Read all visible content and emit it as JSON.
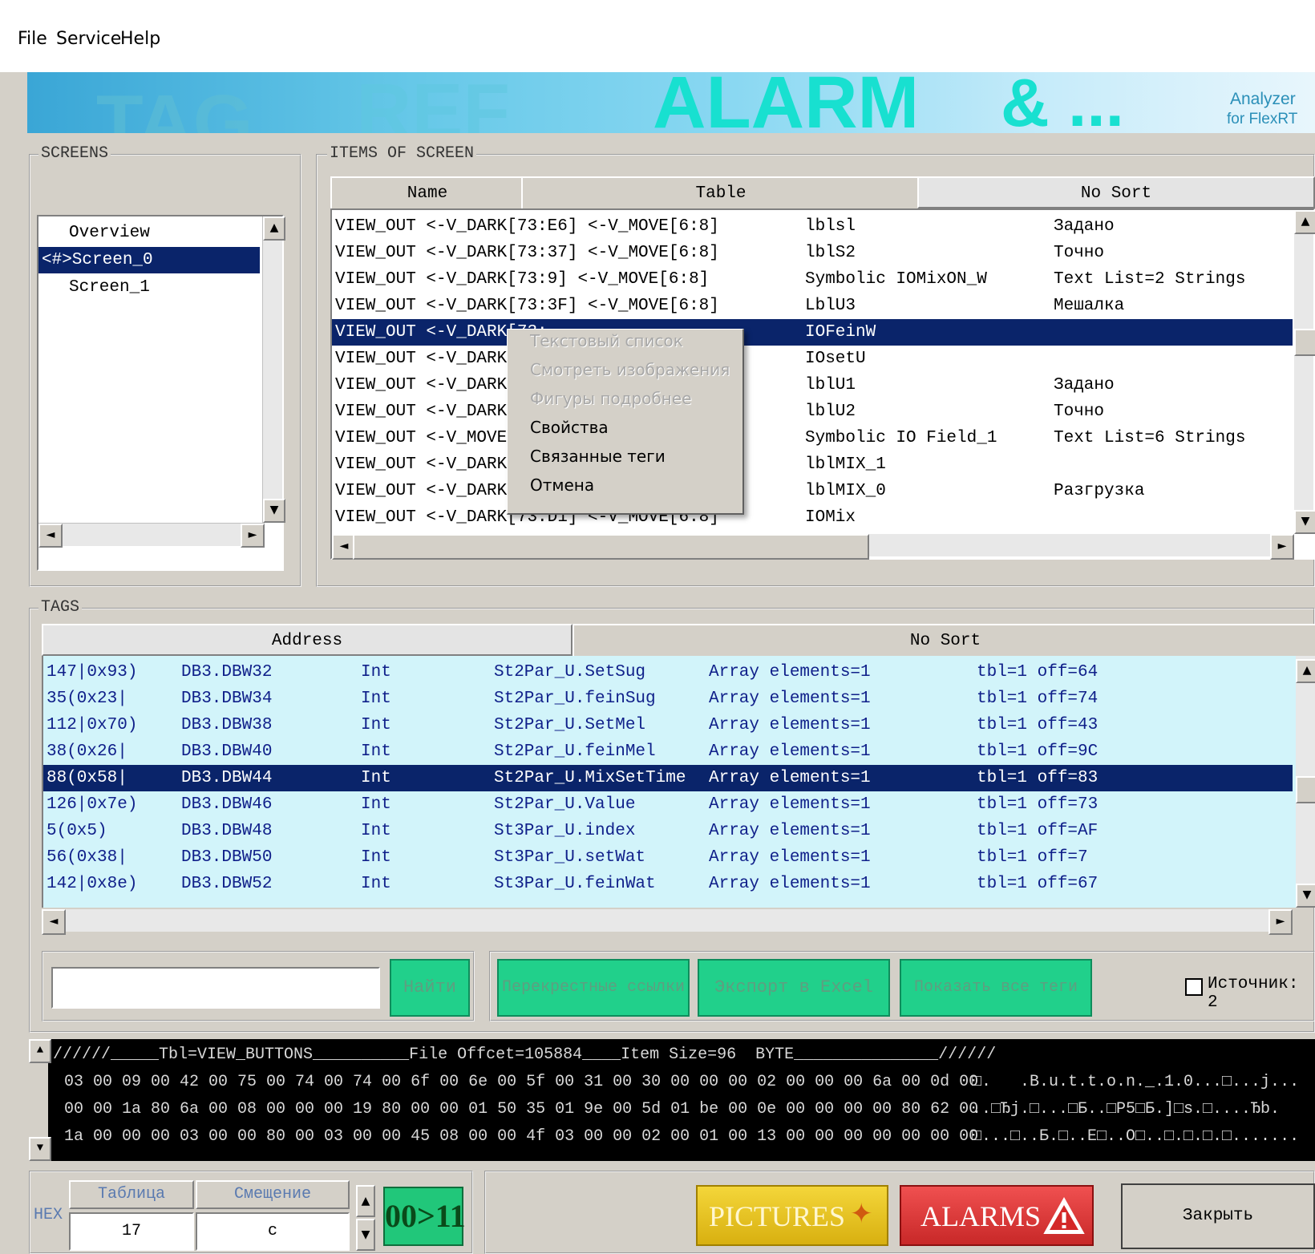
{
  "menu": [
    "File",
    "Service",
    "Help"
  ],
  "banner": {
    "w1": "TAG",
    "w2": "REF",
    "w3": "ALARM",
    "w4": "& ...",
    "analyzer_line1": "Analyzer",
    "analyzer_line2": "for FlexRT"
  },
  "screens": {
    "legend": "SCREENS",
    "items": [
      "Overview",
      "<#>Screen_0",
      "Screen_1"
    ],
    "selected_index": 1
  },
  "items_of_screen": {
    "legend": "ITEMS OF SCREEN",
    "headers": [
      "Name",
      "Table",
      "No Sort"
    ],
    "rows": [
      {
        "name": "VIEW_OUT <-V_DARK[73:E6] <-V_MOVE[6:8]",
        "table": "lblsl",
        "extra": "Задано"
      },
      {
        "name": "VIEW_OUT <-V_DARK[73:37] <-V_MOVE[6:8]",
        "table": "lblS2",
        "extra": "Точно"
      },
      {
        "name": "VIEW_OUT <-V_DARK[73:9] <-V_MOVE[6:8]",
        "table": "Symbolic IOMixON_W",
        "extra": "Text List=2 Strings"
      },
      {
        "name": "VIEW_OUT <-V_DARK[73:3F] <-V_MOVE[6:8]",
        "table": "LblU3",
        "extra": "Мешалка"
      },
      {
        "name": "VIEW_OUT <-V_DARK[73:",
        "table": "IOFeinW",
        "extra": ""
      },
      {
        "name": "VIEW_OUT <-V_DARK[73:",
        "table": "IOsetU",
        "extra": ""
      },
      {
        "name": "VIEW_OUT <-V_DARK[73:",
        "table": "lblU1",
        "extra": "Задано"
      },
      {
        "name": "VIEW_OUT <-V_DARK[73:",
        "table": "lblU2",
        "extra": "Точно"
      },
      {
        "name": "VIEW_OUT <-V_MOVE[6:8",
        "table": "Symbolic IO Field_1",
        "extra": "Text List=6 Strings"
      },
      {
        "name": "VIEW_OUT <-V_DARK[73:",
        "table": "lblMIX_1",
        "extra": ""
      },
      {
        "name": "VIEW_OUT <-V_DARK[73:",
        "table": "lblMIX_0",
        "extra": "Разгрузка"
      },
      {
        "name": "VIEW_OUT <-V_DARK[73:D1] <-V_MOVE[6:8]",
        "table": "IOMix",
        "extra": ""
      }
    ],
    "selected_index": 4
  },
  "context_menu": {
    "items": [
      "Текстовый список",
      "Смотреть изображения",
      "Фигуры подробнее",
      "Свойства",
      "Связанные теги",
      "Отмена"
    ],
    "disabled": [
      true,
      true,
      true,
      false,
      false,
      false
    ]
  },
  "tags": {
    "legend": "TAGS",
    "headers": [
      "Address",
      "No Sort"
    ],
    "rows": [
      [
        "147|0x93)",
        "DB3.DBW32",
        "Int",
        "St2Par_U.SetSug",
        "Array elements=1",
        "tbl=1 off=64"
      ],
      [
        "35(0x23|",
        "DB3.DBW34",
        "Int",
        "St2Par_U.feinSug",
        "Array elements=1",
        "tbl=1 off=74"
      ],
      [
        "112|0x70)",
        "DB3.DBW38",
        "Int",
        "St2Par_U.SetMel",
        "Array elements=1",
        "tbl=1 off=43"
      ],
      [
        "38(0x26|",
        "DB3.DBW40",
        "Int",
        "St2Par_U.feinMel",
        "Array elements=1",
        "tbl=1 off=9C"
      ],
      [
        "88(0x58|",
        "DB3.DBW44",
        "Int",
        "St2Par_U.MixSetTime",
        "Array elements=1",
        "tbl=1 off=83"
      ],
      [
        "126|0x7e)",
        "DB3.DBW46",
        "Int",
        "St2Par_U.Value",
        "Array elements=1",
        "tbl=1 off=73"
      ],
      [
        "5(0x5)",
        "DB3.DBW48",
        "Int",
        "St3Par_U.index",
        "Array elements=1",
        "tbl=1 off=AF"
      ],
      [
        "56(0x38|",
        "DB3.DBW50",
        "Int",
        "St3Par_U.setWat",
        "Array elements=1",
        "tbl=1 off=7"
      ],
      [
        "142|0x8e)",
        "DB3.DBW52",
        "Int",
        "St3Par_U.feinWat",
        "Array elements=1",
        "tbl=1 off=67"
      ]
    ],
    "selected_index": 4
  },
  "search": {
    "value": "",
    "find_label": "Найти"
  },
  "actions": {
    "cross_refs": "Перекрестные ссылки",
    "export_excel": "Экспорт в Excel",
    "show_all": "Показать все теги",
    "sources_label": "Источник: 2"
  },
  "hexdump": {
    "header": "//////_____Tbl=VIEW_BUTTONS__________File Offcet=105884____Item Size=96  BYTE_______________//////",
    "lines": [
      "03 00 09 00 42 00 75 00 74 00 74 00 6f 00 6e 00 5f 00 31 00 30 00 00 00 02 00 00 00 6a 00 0d 00",
      "00 00 1a 80 6a 00 08 00 00 00 19 80 00 00 01 50 35 01 9e 00 5d 01 be 00 0e 00 00 00 00 80 62 00",
      "1a 00 00 00 03 00 00 80 00 03 00 00 45 08 00 00 4f 03 00 00 02 00 01 00 13 00 00 00 00 00 00 00"
    ],
    "ascii": [
      "□.   .B.u.t.t.o.n._.1.0...□...j...",
      "..□Ђj.□...□Б..□P5□Б.]□s.□....Ђb.",
      "□...□..Б.□..E□..O□..□.□.□.□......."
    ]
  },
  "bottom": {
    "hex_label": "HEX",
    "table_header": "Таблица",
    "offset_header": "Смещение",
    "table_value": "17",
    "offset_value": "c",
    "convert_label": "00>11",
    "pictures_label": "PICTURES",
    "alarms_label": "ALARMS",
    "close_label": "Закрыть"
  },
  "colors": {
    "selection": "#0a246a",
    "tags_bg": "#d2f4fa",
    "green_button": "#21d08b",
    "pictures": "#e8c21a",
    "alarms": "#e13c3c"
  }
}
